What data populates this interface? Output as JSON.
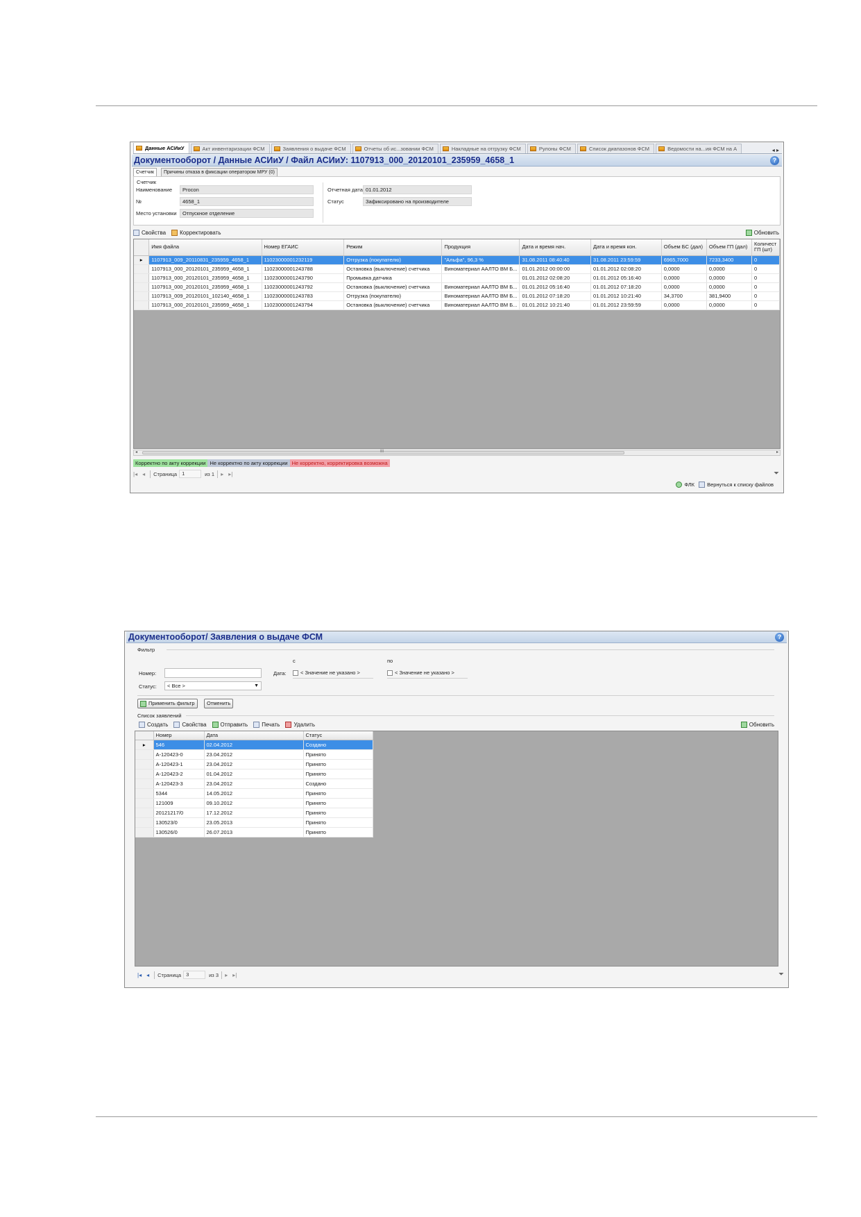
{
  "window1": {
    "tabs": [
      {
        "label": "Данные АСИиУ",
        "active": true
      },
      {
        "label": "Акт инвентаризации ФСМ"
      },
      {
        "label": "Заявления о выдаче ФСМ"
      },
      {
        "label": "Отчеты об ис...зовании ФСМ"
      },
      {
        "label": "Накладные на отгрузку ФСМ"
      },
      {
        "label": "Рулоны ФСМ"
      },
      {
        "label": "Список диапазонов ФСМ"
      },
      {
        "label": "Ведомости на...ия ФСМ на А"
      }
    ],
    "tab_nav": "◂ ▸",
    "title": "Документооборот / Данные АСИиУ / Файл АСИиУ: 1107913_000_20120101_235959_4658_1",
    "help_icon": "?",
    "subtabs": [
      "Счетчик",
      "Причины отказа в фиксации оператором МРУ (0)"
    ],
    "counter": {
      "group_label": "Счетчик",
      "name_label": "Наименование",
      "name_value": "Procon",
      "number_label": "№",
      "number_value": "4658_1",
      "place_label": "Место установки",
      "place_value": "Отпускное отделение",
      "report_date_label": "Отчетная дата",
      "report_date_value": "01.01.2012",
      "status_label": "Статус",
      "status_value": "Зафиксировано на производителе"
    },
    "toolbar": {
      "properties": "Свойства",
      "correct": "Корректировать",
      "refresh": "Обновить"
    },
    "table": {
      "columns": [
        "Имя файла",
        "Номер ЕГАИС",
        "Режим",
        "Продукция",
        "Дата и время нач.",
        "Дата и время кон.",
        "Объем БС (дал)",
        "Объем ГП (дал)",
        "Количест ГП (шт)"
      ],
      "rows": [
        [
          "1107913_009_20110831_235959_4658_1",
          "11023000001232119",
          "Отгрузка (покупателю)",
          "\"Альфа\", 96,3 %",
          "31.08.2011 08:40:40",
          "31.08.2011 23:59:59",
          "6965,7000",
          "7233,3400",
          "0"
        ],
        [
          "1107913_000_20120101_235959_4658_1",
          "11023000001243788",
          "Остановка (выключение) счетчика",
          "Виноматериал ААЛТО ВМ Б...",
          "01.01.2012 00:00:00",
          "01.01.2012 02:08:20",
          "0,0000",
          "0,0000",
          "0"
        ],
        [
          "1107913_000_20120101_235959_4658_1",
          "11023000001243790",
          "Промывка датчика",
          "",
          "01.01.2012 02:08:20",
          "01.01.2012 05:16:40",
          "0,0000",
          "0,0000",
          "0"
        ],
        [
          "1107913_000_20120101_235959_4658_1",
          "11023000001243792",
          "Остановка (выключение) счетчика",
          "Виноматериал ААЛТО ВМ Б...",
          "01.01.2012 05:16:40",
          "01.01.2012 07:18:20",
          "0,0000",
          "0,0000",
          "0"
        ],
        [
          "1107913_009_20120101_102140_4658_1",
          "11023000001243783",
          "Отгрузка (покупателю)",
          "Виноматериал ААЛТО ВМ Б...",
          "01.01.2012 07:18:20",
          "01.01.2012 10:21:40",
          "34,3700",
          "381,9400",
          "0"
        ],
        [
          "1107913_000_20120101_235959_4658_1",
          "11023000001243794",
          "Остановка (выключение) счетчика",
          "Виноматериал ААЛТО ВМ Б...",
          "01.01.2012 10:21:40",
          "01.01.2012 23:59:59",
          "0,0000",
          "0,0000",
          "0"
        ]
      ]
    },
    "scroll_grip": "III",
    "legend": [
      "Корректно по акту коррекции",
      "Не корректно по акту коррекции",
      "Не корректно, корректировка возможна"
    ],
    "pager": {
      "page_label": "Страница",
      "page": "1",
      "of_label": "из",
      "total": "1"
    },
    "status_buttons": {
      "flk": "ФЛК",
      "back": "Вернуться к списку файлов"
    }
  },
  "window2": {
    "title": "Документооборот/ Заявления о выдаче ФСМ",
    "help_icon": "?",
    "filter": {
      "group_label": "Фильтр",
      "number_label": "Номер:",
      "number_value": "",
      "date_label": "Дата:",
      "from_label": "с",
      "to_label": "по",
      "from_value": "< Значение не указано >",
      "to_value": "< Значение не указано >",
      "status_label": "Статус:",
      "status_value": "< Все >",
      "apply_button": "Применить фильтр",
      "cancel_button": "Отменить"
    },
    "list_label": "Список заявлений",
    "toolbar": {
      "create": "Создать",
      "properties": "Свойства",
      "send": "Отправить",
      "print": "Печать",
      "delete": "Удалить",
      "refresh": "Обновить"
    },
    "table": {
      "columns": [
        "Номер",
        "Дата",
        "Статус"
      ],
      "rows": [
        [
          "546",
          "02.04.2012",
          "Создано"
        ],
        [
          "А-120423-0",
          "23.04.2012",
          "Принято"
        ],
        [
          "А-120423-1",
          "23.04.2012",
          "Принято"
        ],
        [
          "А-120423-2",
          "01.04.2012",
          "Принято"
        ],
        [
          "А-120423-3",
          "23.04.2012",
          "Создано"
        ],
        [
          "5344",
          "14.05.2012",
          "Принято"
        ],
        [
          "121009",
          "09.10.2012",
          "Принято"
        ],
        [
          "20121217/0",
          "17.12.2012",
          "Принято"
        ],
        [
          "130523/0",
          "23.05.2013",
          "Принято"
        ],
        [
          "130526/0",
          "26.07.2013",
          "Принято"
        ]
      ]
    },
    "pager": {
      "page_label": "Страница",
      "page": "3",
      "of_label": "из",
      "total": "3"
    }
  },
  "colors": {
    "selection": "#3d8ee6",
    "title_text": "#1a2d8a",
    "grid_background": "#a9a9a9",
    "legend_ok": "#9ee29e",
    "legend_bad": "#bfc8d8",
    "legend_fixable": "#f2a0a8"
  }
}
